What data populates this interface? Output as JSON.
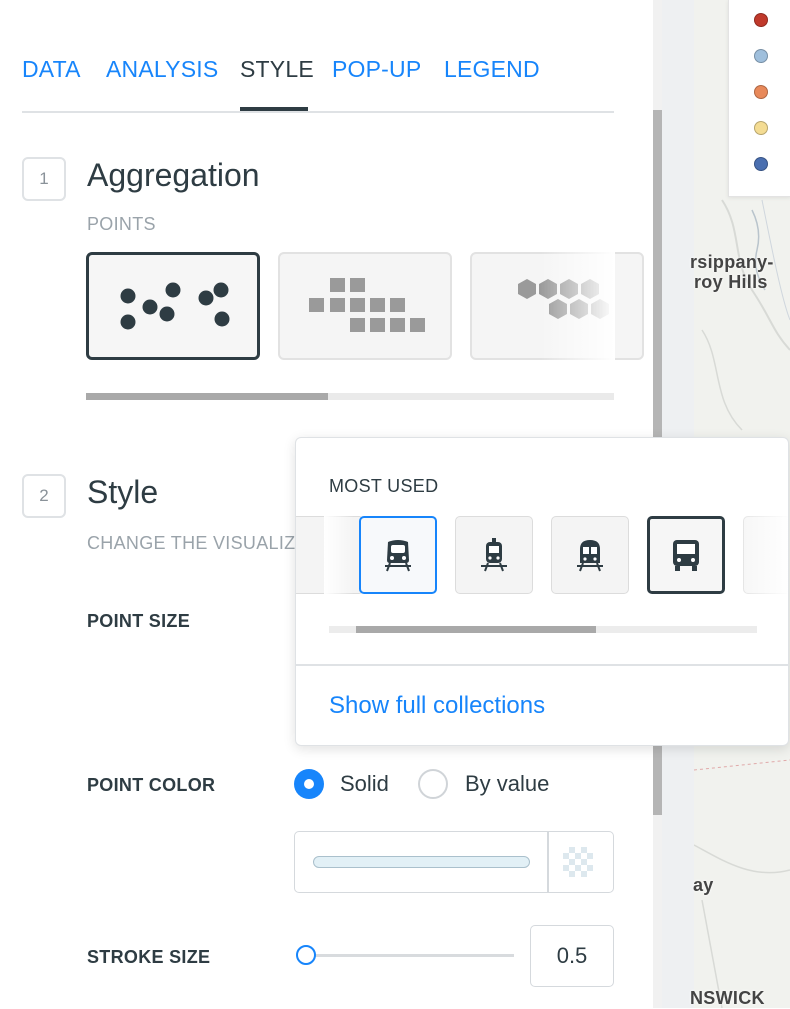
{
  "tabs": [
    "DATA",
    "ANALYSIS",
    "STYLE",
    "POP-UP",
    "LEGEND"
  ],
  "section1": {
    "number": "1",
    "title": "Aggregation",
    "subtitle": "POINTS"
  },
  "section2": {
    "number": "2",
    "title": "Style",
    "subtitle": "CHANGE THE VISUALIZ"
  },
  "properties": {
    "point_size": "POINT SIZE",
    "point_color": "POINT COLOR",
    "stroke_size": "STROKE SIZE",
    "color_mode_solid": "Solid",
    "color_mode_by_value": "By value",
    "stroke_value": "0.5"
  },
  "popup": {
    "title": "MOST USED",
    "link": "Show full collections",
    "icons": [
      "train-front-icon",
      "tram-icon",
      "metro-icon",
      "bus-icon"
    ]
  },
  "map": {
    "labels": [
      "rsippany-",
      "roy Hills",
      "ay",
      "NSWICK"
    ],
    "legend_colors": [
      "#c0392b",
      "#9fbfdc",
      "#e8895a",
      "#f4dc93",
      "#4a6fb0"
    ]
  },
  "colors": {
    "accent": "#1785fb",
    "text": "#2e3c43"
  }
}
